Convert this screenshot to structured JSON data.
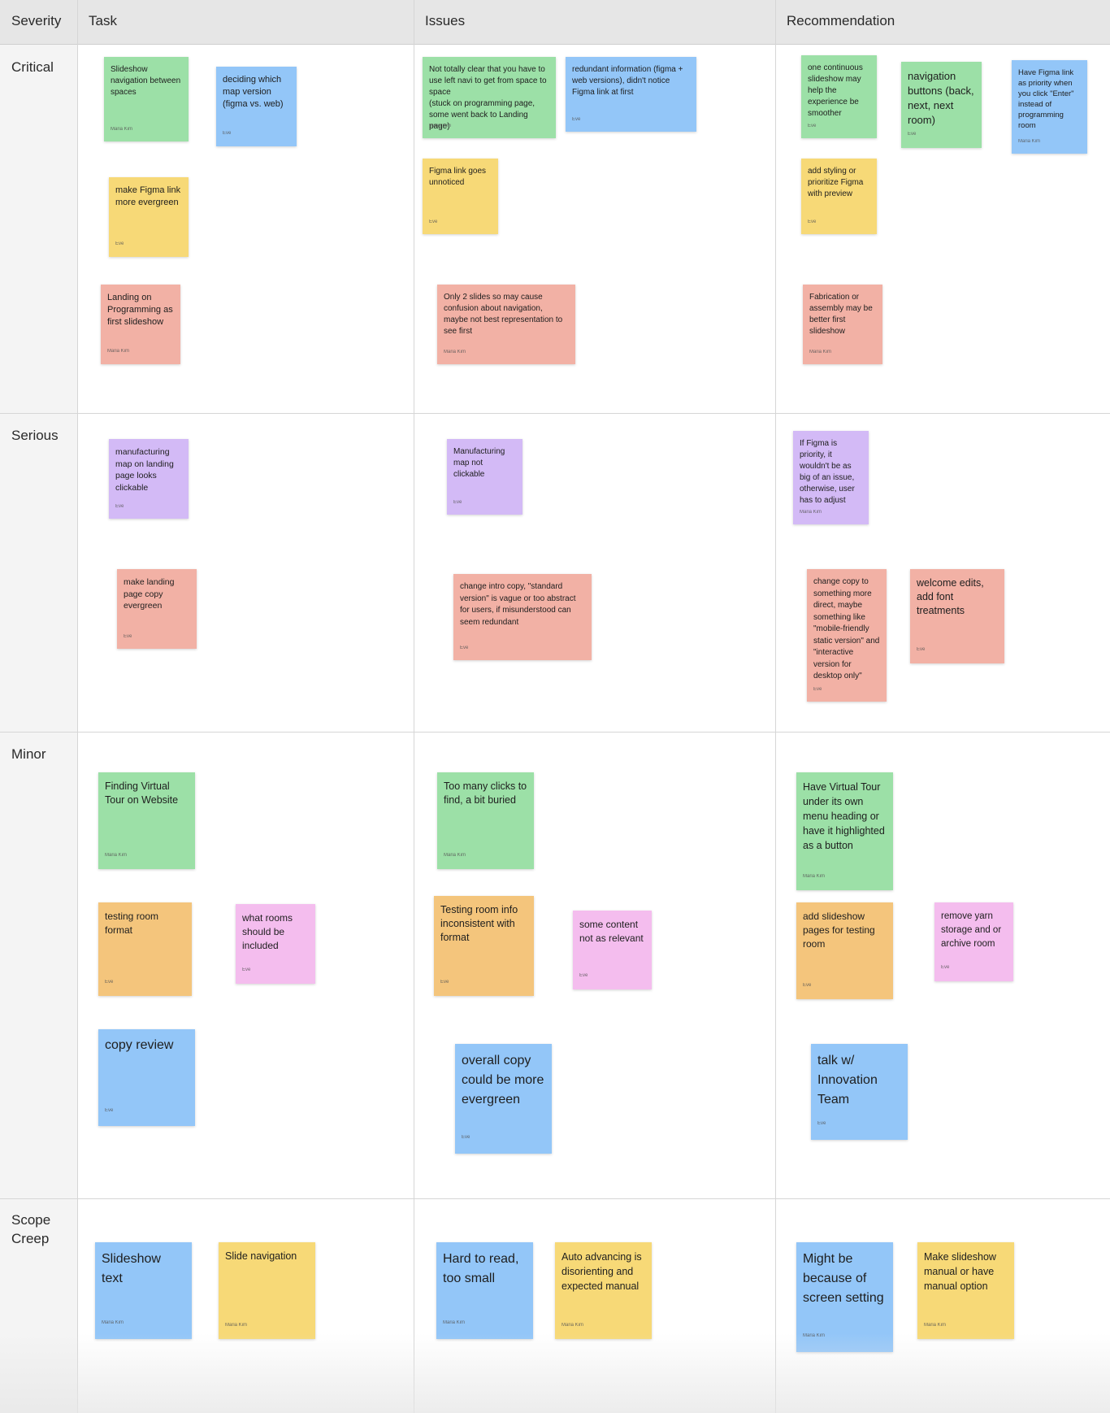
{
  "columns": {
    "severity": "Severity",
    "task": "Task",
    "issues": "Issues",
    "recommendation": "Recommendation"
  },
  "rows": {
    "critical": "Critical",
    "serious": "Serious",
    "minor": "Minor",
    "scope_creep": "Scope\nCreep"
  },
  "notes": {
    "c1": {
      "text": "Slideshow navigation between spaces",
      "author": "Maria Kim"
    },
    "c2": {
      "text": "deciding which map version (figma vs. web)",
      "author": "Eve"
    },
    "c3": {
      "text": "make Figma link more evergreen",
      "author": "Eve"
    },
    "c4": {
      "text": "Landing on Programming as first slideshow",
      "author": "Maria Kim"
    },
    "c5": {
      "text": "Not totally clear that you have to use left navi to get from space to space\n(stuck on programming page, some went back to Landing page)",
      "author": "Maria Kim"
    },
    "c6": {
      "text": "redundant information (figma + web versions), didn't notice Figma link at first",
      "author": "Eve"
    },
    "c7": {
      "text": "Figma link goes unnoticed",
      "author": "Eve"
    },
    "c8": {
      "text": "Only 2 slides so may cause confusion about navigation, maybe not best representation to see first",
      "author": "Maria Kim"
    },
    "c9": {
      "text": "one continuous slideshow may help the experience be smoother",
      "author": "Eve"
    },
    "c10": {
      "text": "navigation buttons (back, next, next room)",
      "author": "Eve"
    },
    "c11": {
      "text": "Have Figma link as priority when you click \"Enter\" instead of programming room",
      "author": "Maria Kim"
    },
    "c12": {
      "text": "add styling or prioritize Figma with preview",
      "author": "Eve"
    },
    "c13": {
      "text": "Fabrication or assembly may be better first slideshow",
      "author": "Maria Kim"
    },
    "s1": {
      "text": "manufacturing map on landing page looks clickable",
      "author": "Eve"
    },
    "s2": {
      "text": "make landing page copy evergreen",
      "author": "Eve"
    },
    "s3": {
      "text": "Manufacturing map not clickable",
      "author": "Eve"
    },
    "s4": {
      "text": "change intro copy, \"standard version\" is vague or too abstract for users, if misunderstood can seem redundant",
      "author": "Eve"
    },
    "s5": {
      "text": "If Figma is priority, it wouldn't be as big of an issue, otherwise, user has to adjust",
      "author": "Maria Kim"
    },
    "s6": {
      "text": "change copy to something more direct, maybe something like \"mobile-friendly static version\" and \"interactive version for desktop only\"",
      "author": "Eve"
    },
    "s7": {
      "text": "welcome edits, add font treatments",
      "author": "Eve"
    },
    "m1": {
      "text": "Finding Virtual Tour on Website",
      "author": "Maria Kim"
    },
    "m2": {
      "text": "testing room format",
      "author": "Eve"
    },
    "m3": {
      "text": "what rooms should be included",
      "author": "Eve"
    },
    "m4": {
      "text": "copy review",
      "author": "Eve"
    },
    "m5": {
      "text": "Too many clicks to find, a bit buried",
      "author": "Maria Kim"
    },
    "m6": {
      "text": "Testing room info inconsistent with format",
      "author": "Eve"
    },
    "m7": {
      "text": "some content not as relevant",
      "author": "Eve"
    },
    "m8": {
      "text": "overall copy could be more evergreen",
      "author": "Eve"
    },
    "m9": {
      "text": "Have Virtual Tour under its own menu heading or have it highlighted as a button",
      "author": "Maria Kim"
    },
    "m10": {
      "text": "add slideshow pages for testing room",
      "author": "Eve"
    },
    "m11": {
      "text": "remove yarn storage and or archive room",
      "author": "Eve"
    },
    "m12": {
      "text": "talk w/ Innovation Team",
      "author": "Eve"
    },
    "sc1": {
      "text": "Slideshow text",
      "author": "Maria Kim"
    },
    "sc2": {
      "text": "Slide navigation",
      "author": "Maria Kim"
    },
    "sc3": {
      "text": "Hard to read, too small",
      "author": "Maria Kim"
    },
    "sc4": {
      "text": "Auto advancing is disorienting and expected manual",
      "author": "Maria Kim"
    },
    "sc5": {
      "text": "Might be because of screen setting",
      "author": "Maria Kim"
    },
    "sc6": {
      "text": "Make slideshow manual or have manual option",
      "author": "Maria Kim"
    }
  },
  "colors": {
    "green": "#9ce0a7",
    "blue": "#93c6f8",
    "yellow": "#f7d977",
    "red": "#f2b1a5",
    "purple": "#d3baf6",
    "orange": "#f4c57c",
    "pink": "#f4bdee"
  }
}
